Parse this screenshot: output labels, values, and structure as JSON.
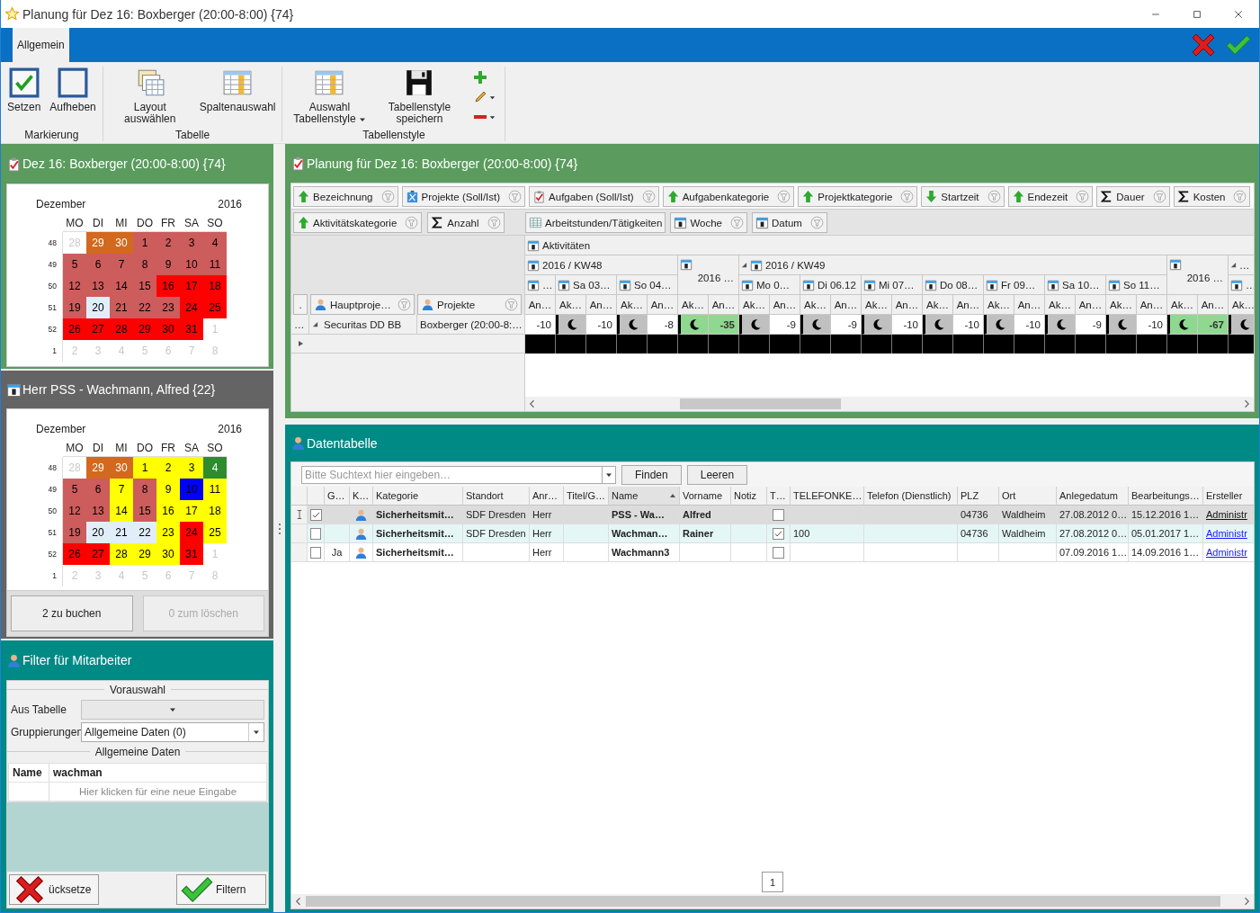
{
  "window": {
    "title": "Planung für Dez 16: Boxberger (20:00-8:00) {74}"
  },
  "ribbon": {
    "tabs": [
      {
        "label": "Allgemein",
        "selected": true
      }
    ],
    "groups": [
      {
        "label": "Markierung",
        "buttons": [
          {
            "label": "Setzen",
            "kind": "check",
            "dropdown": false
          },
          {
            "label": "Aufheben",
            "kind": "uncheck",
            "dropdown": false
          }
        ]
      },
      {
        "label": "Tabelle",
        "buttons": [
          {
            "label": "Layout auswählen",
            "kind": "layouts",
            "dropdown": false
          },
          {
            "label": "Spaltenauswahl",
            "kind": "columns",
            "dropdown": false
          }
        ]
      },
      {
        "label": "Tabellenstyle",
        "buttons": [
          {
            "label": "Auswahl Tabellenstyle",
            "kind": "styles",
            "dropdown": true
          },
          {
            "label": "Tabellenstyle speichern",
            "kind": "save",
            "dropdown": false
          }
        ]
      }
    ]
  },
  "booking_calendar": {
    "title": "Dez 16: Boxberger (20:00-8:00) {74}",
    "month": "Dezember",
    "year": "2016",
    "weekdays": [
      "MO",
      "DI",
      "MI",
      "DO",
      "FR",
      "SA",
      "SO"
    ],
    "weeks": [
      {
        "number": "48",
        "days": [
          {
            "day": "28",
            "outside": true
          },
          {
            "day": "29",
            "outside": false,
            "color": "#d2691e"
          },
          {
            "day": "30",
            "outside": false,
            "color": "#d2691e"
          },
          {
            "day": "1",
            "outside": false,
            "color": "#cd5c5c"
          },
          {
            "day": "2",
            "outside": false,
            "color": "#cd5c5c"
          },
          {
            "day": "3",
            "outside": false,
            "color": "#cd5c5c"
          },
          {
            "day": "4",
            "outside": false,
            "color": "#cd5c5c"
          }
        ]
      },
      {
        "number": "49",
        "days": [
          {
            "day": "5",
            "outside": false,
            "color": "#cd5c5c"
          },
          {
            "day": "6",
            "outside": false,
            "color": "#cd5c5c"
          },
          {
            "day": "7",
            "outside": false,
            "color": "#cd5c5c"
          },
          {
            "day": "8",
            "outside": false,
            "color": "#cd5c5c"
          },
          {
            "day": "9",
            "outside": false,
            "color": "#cd5c5c"
          },
          {
            "day": "10",
            "outside": false,
            "color": "#cd5c5c"
          },
          {
            "day": "11",
            "outside": false,
            "color": "#cd5c5c"
          }
        ]
      },
      {
        "number": "50",
        "days": [
          {
            "day": "12",
            "outside": false,
            "color": "#cd5c5c"
          },
          {
            "day": "13",
            "outside": false,
            "color": "#cd5c5c"
          },
          {
            "day": "14",
            "outside": false,
            "color": "#cd5c5c"
          },
          {
            "day": "15",
            "outside": false,
            "color": "#cd5c5c"
          },
          {
            "day": "16",
            "outside": false,
            "color": "#ff0000"
          },
          {
            "day": "17",
            "outside": false,
            "color": "#ff0000"
          },
          {
            "day": "18",
            "outside": false,
            "color": "#ff0000"
          }
        ]
      },
      {
        "number": "51",
        "days": [
          {
            "day": "19",
            "outside": false,
            "color": "#cd5c5c"
          },
          {
            "day": "20",
            "outside": false,
            "color": "#e1eefa"
          },
          {
            "day": "21",
            "outside": false,
            "color": "#cd5c5c"
          },
          {
            "day": "22",
            "outside": false,
            "color": "#cd5c5c"
          },
          {
            "day": "23",
            "outside": false,
            "color": "#cd5c5c"
          },
          {
            "day": "24",
            "outside": false,
            "color": "#ff0000"
          },
          {
            "day": "25",
            "outside": false,
            "color": "#ff0000"
          }
        ]
      },
      {
        "number": "52",
        "days": [
          {
            "day": "26",
            "outside": false,
            "color": "#ff0000"
          },
          {
            "day": "27",
            "outside": false,
            "color": "#ff0000"
          },
          {
            "day": "28",
            "outside": false,
            "color": "#ff0000"
          },
          {
            "day": "29",
            "outside": false,
            "color": "#ff0000"
          },
          {
            "day": "30",
            "outside": false,
            "color": "#ff0000"
          },
          {
            "day": "31",
            "outside": false,
            "color": "#ff0000"
          },
          {
            "day": "1",
            "outside": true
          }
        ]
      },
      {
        "number": "1",
        "days": [
          {
            "day": "2",
            "outside": true
          },
          {
            "day": "3",
            "outside": true
          },
          {
            "day": "4",
            "outside": true
          },
          {
            "day": "5",
            "outside": true
          },
          {
            "day": "6",
            "outside": true
          },
          {
            "day": "7",
            "outside": true
          },
          {
            "day": "8",
            "outside": true
          }
        ]
      }
    ]
  },
  "employee_calendar": {
    "title": "Herr PSS - Wachmann, Alfred {22}",
    "month": "Dezember",
    "year": "2016",
    "weekdays": [
      "MO",
      "DI",
      "MI",
      "DO",
      "FR",
      "SA",
      "SO"
    ],
    "weeks": [
      {
        "number": "48",
        "days": [
          {
            "day": "28",
            "outside": true
          },
          {
            "day": "29",
            "outside": false,
            "color": "#d2691e"
          },
          {
            "day": "30",
            "outside": false,
            "color": "#d2691e"
          },
          {
            "day": "1",
            "outside": false,
            "color": "#ffff00"
          },
          {
            "day": "2",
            "outside": false,
            "color": "#ffff00"
          },
          {
            "day": "3",
            "outside": false,
            "color": "#ffff00"
          },
          {
            "day": "4",
            "outside": false,
            "color": "#2e8b2e"
          }
        ]
      },
      {
        "number": "49",
        "days": [
          {
            "day": "5",
            "outside": false,
            "color": "#cd5c5c"
          },
          {
            "day": "6",
            "outside": false,
            "color": "#cd5c5c"
          },
          {
            "day": "7",
            "outside": false,
            "color": "#ffff00"
          },
          {
            "day": "8",
            "outside": false,
            "color": "#cd5c5c"
          },
          {
            "day": "9",
            "outside": false,
            "color": "#ffff00"
          },
          {
            "day": "10",
            "outside": false,
            "color": "#0000ff"
          },
          {
            "day": "11",
            "outside": false,
            "color": "#ffff00"
          }
        ]
      },
      {
        "number": "50",
        "days": [
          {
            "day": "12",
            "outside": false,
            "color": "#cd5c5c"
          },
          {
            "day": "13",
            "outside": false,
            "color": "#cd5c5c"
          },
          {
            "day": "14",
            "outside": false,
            "color": "#ffff00"
          },
          {
            "day": "15",
            "outside": false,
            "color": "#cd5c5c"
          },
          {
            "day": "16",
            "outside": false,
            "color": "#ffff00"
          },
          {
            "day": "17",
            "outside": false,
            "color": "#ffff00"
          },
          {
            "day": "18",
            "outside": false,
            "color": "#ffff00"
          }
        ]
      },
      {
        "number": "51",
        "days": [
          {
            "day": "19",
            "outside": false,
            "color": "#cd5c5c"
          },
          {
            "day": "20",
            "outside": false,
            "color": "#e1eefa"
          },
          {
            "day": "21",
            "outside": false,
            "color": "#e1eefa"
          },
          {
            "day": "22",
            "outside": false,
            "color": "#e1eefa"
          },
          {
            "day": "23",
            "outside": false,
            "color": "#ffff00"
          },
          {
            "day": "24",
            "outside": false,
            "color": "#ff0000"
          },
          {
            "day": "25",
            "outside": false,
            "color": "#ffff00"
          }
        ]
      },
      {
        "number": "52",
        "days": [
          {
            "day": "26",
            "outside": false,
            "color": "#ff0000"
          },
          {
            "day": "27",
            "outside": false,
            "color": "#ff0000"
          },
          {
            "day": "28",
            "outside": false,
            "color": "#ffff00"
          },
          {
            "day": "29",
            "outside": false,
            "color": "#ffff00"
          },
          {
            "day": "30",
            "outside": false,
            "color": "#ffff00"
          },
          {
            "day": "31",
            "outside": false,
            "color": "#ff0000"
          },
          {
            "day": "1",
            "outside": true
          }
        ]
      },
      {
        "number": "1",
        "days": [
          {
            "day": "2",
            "outside": true
          },
          {
            "day": "3",
            "outside": true
          },
          {
            "day": "4",
            "outside": true
          },
          {
            "day": "5",
            "outside": true
          },
          {
            "day": "6",
            "outside": true
          },
          {
            "day": "7",
            "outside": true
          },
          {
            "day": "8",
            "outside": true
          }
        ]
      }
    ],
    "buttons": [
      {
        "label": "2 zu buchen",
        "disabled": false
      },
      {
        "label": "0 zum löschen",
        "disabled": true
      }
    ]
  },
  "employee_filter": {
    "title": "Filter für Mitarbeiter",
    "preselection": {
      "legend": "Vorauswahl",
      "fields": [
        {
          "label": "Aus Tabelle",
          "disabled": true
        },
        {
          "label": "Gruppierungen",
          "value": "Allgemeine Daten (0)",
          "disabled": false
        }
      ]
    },
    "general": {
      "legend": "Allgemeine Daten",
      "rows": [
        {
          "name": "Name",
          "value": "wachman"
        }
      ],
      "new_row_hint": "Hier klicken für eine neue Eingabe"
    },
    "buttons": [
      {
        "label": "ücksetze",
        "kind": "reset"
      },
      {
        "label": "Filtern",
        "kind": "apply"
      }
    ]
  },
  "planning": {
    "title": "Planung für Dez 16: Boxberger (20:00-8:00) {74}",
    "filter_fields": [
      {
        "label": "Bezeichnung",
        "kind": "ascending",
        "filter": true
      },
      {
        "label": "Projekte (Soll/Ist)",
        "kind": "projects",
        "filter": true
      },
      {
        "label": "Aufgaben (Soll/Ist)",
        "kind": "tasks",
        "filter": true
      },
      {
        "label": "Aufgabenkategorie",
        "kind": "ascending",
        "filter": true
      },
      {
        "label": "Projektkategorie",
        "kind": "ascending",
        "filter": true
      },
      {
        "label": "Startzeit",
        "kind": "descending",
        "filter": true
      },
      {
        "label": "Endezeit",
        "kind": "ascending",
        "filter": true
      },
      {
        "label": "Dauer",
        "kind": "sum",
        "filter": true
      },
      {
        "label": "Kosten",
        "kind": "sum",
        "filter": true
      }
    ],
    "data_fields": [
      {
        "label": "Aktivitätskategorie",
        "kind": "ascending",
        "filter": true
      },
      {
        "label": "Anzahl",
        "kind": "sum",
        "filter": true
      }
    ],
    "column_fields": [
      {
        "label": "Arbeitstunden/Tätigkeiten",
        "kind": "grid",
        "filter": false
      },
      {
        "label": "Woche",
        "kind": "date",
        "filter": true
      },
      {
        "label": "Datum",
        "kind": "date",
        "filter": true
      }
    ],
    "row_field_stub": ".",
    "row_fields": [
      {
        "label": "Hauptproje…",
        "kind": "person",
        "filter": true
      },
      {
        "label": "Projekte",
        "kind": "person",
        "filter": true
      }
    ],
    "column_root": "Aktivitäten",
    "column_groups": [
      {
        "kind": "week",
        "label": "2016 / KW48",
        "expanded": false,
        "days": [
          {
            "label": "…",
            "cells": [
              {
                "header": "An…",
                "kind": "number",
                "value": "-10"
              }
            ]
          },
          {
            "label": "Sa 03…",
            "cells": [
              {
                "header": "Ak…",
                "kind": "moon"
              },
              {
                "header": "An…",
                "kind": "number",
                "value": "-10"
              }
            ]
          },
          {
            "label": "So 04…",
            "cells": [
              {
                "header": "Ak…",
                "kind": "moon"
              },
              {
                "header": "An…",
                "kind": "number",
                "value": "-8"
              }
            ]
          }
        ]
      },
      {
        "kind": "total",
        "label": "2016 …",
        "cells": [
          {
            "header": "Ak…",
            "kind": "moon"
          },
          {
            "header": "An…",
            "kind": "number",
            "value": "-35"
          }
        ]
      },
      {
        "kind": "week",
        "label": "2016 / KW49",
        "expanded": true,
        "days": [
          {
            "label": "Mo 0…",
            "cells": [
              {
                "header": "Ak…",
                "kind": "moon"
              },
              {
                "header": "An…",
                "kind": "number",
                "value": "-9"
              }
            ]
          },
          {
            "label": "Di 06.12",
            "cells": [
              {
                "header": "Ak…",
                "kind": "moon"
              },
              {
                "header": "An…",
                "kind": "number",
                "value": "-9"
              }
            ]
          },
          {
            "label": "Mi 07…",
            "cells": [
              {
                "header": "Ak…",
                "kind": "moon"
              },
              {
                "header": "An…",
                "kind": "number",
                "value": "-10"
              }
            ]
          },
          {
            "label": "Do 08…",
            "cells": [
              {
                "header": "Ak…",
                "kind": "moon"
              },
              {
                "header": "An…",
                "kind": "number",
                "value": "-10"
              }
            ]
          },
          {
            "label": "Fr 09…",
            "cells": [
              {
                "header": "Ak…",
                "kind": "moon"
              },
              {
                "header": "An…",
                "kind": "number",
                "value": "-10"
              }
            ]
          },
          {
            "label": "Sa 10…",
            "cells": [
              {
                "header": "Ak…",
                "kind": "moon"
              },
              {
                "header": "An…",
                "kind": "number",
                "value": "-9"
              }
            ]
          },
          {
            "label": "So 11…",
            "cells": [
              {
                "header": "Ak…",
                "kind": "moon"
              },
              {
                "header": "An…",
                "kind": "number",
                "value": "-10"
              }
            ]
          }
        ]
      },
      {
        "kind": "total",
        "label": "2016 …",
        "cells": [
          {
            "header": "Ak…",
            "kind": "moon"
          },
          {
            "header": "An…",
            "kind": "number",
            "value": "-67"
          }
        ]
      },
      {
        "kind": "week",
        "label": "…",
        "expanded": true,
        "days": [
          {
            "label": "…",
            "cells": [
              {
                "header": "Ak…",
                "kind": "moon"
              }
            ]
          }
        ]
      }
    ],
    "rows": [
      {
        "stub": "…",
        "project": "Securitas DD BB",
        "expanded": true,
        "subproject": "Boxberger (20:00-8:…"
      }
    ]
  },
  "data_table": {
    "title": "Datentabelle",
    "search": {
      "placeholder": "Bitte Suchtext hier eingeben…"
    },
    "buttons": [
      "Finden",
      "Leeren"
    ],
    "columns": [
      {
        "label": "G…",
        "kind": "text",
        "sorted": false
      },
      {
        "label": "K…",
        "kind": "icon",
        "sorted": false
      },
      {
        "label": "Kategorie",
        "kind": "bold",
        "sorted": false
      },
      {
        "label": "Standort",
        "kind": "text",
        "sorted": false
      },
      {
        "label": "Anr…",
        "kind": "text",
        "sorted": false
      },
      {
        "label": "Titel/G…",
        "kind": "text",
        "sorted": false
      },
      {
        "label": "Name",
        "kind": "bold",
        "sorted": true
      },
      {
        "label": "Vorname",
        "kind": "bold",
        "sorted": false
      },
      {
        "label": "Notiz",
        "kind": "text",
        "sorted": false
      },
      {
        "label": "T…",
        "kind": "check",
        "sorted": false
      },
      {
        "label": "TELEFONKE…",
        "kind": "text",
        "sorted": false
      },
      {
        "label": "Telefon (Dienstlich)",
        "kind": "text",
        "sorted": false
      },
      {
        "label": "PLZ",
        "kind": "text",
        "sorted": false
      },
      {
        "label": "Ort",
        "kind": "text",
        "sorted": false
      },
      {
        "label": "Anlegedatum",
        "kind": "text",
        "sorted": false
      },
      {
        "label": "Bearbeitungs…",
        "kind": "text",
        "sorted": false
      },
      {
        "label": "Ersteller",
        "kind": "link",
        "sorted": false
      }
    ],
    "rows": [
      {
        "selected": true,
        "focused": true,
        "checked": true,
        "cells": [
          {},
          {
            "kind": "person"
          },
          {
            "text": "Sicherheitsmit…"
          },
          {
            "text": "SDF Dresden"
          },
          {
            "text": "Herr"
          },
          {},
          {
            "text": "PSS - Wa…"
          },
          {
            "text": "Alfred"
          },
          {},
          {
            "checked": false
          },
          {},
          {},
          {
            "text": "04736"
          },
          {
            "text": "Waldheim"
          },
          {
            "text": "27.08.2012 0…"
          },
          {
            "text": "15.12.2016 1…"
          },
          {
            "text": "Administr"
          }
        ]
      },
      {
        "selected": false,
        "focused": false,
        "checked": false,
        "cells": [
          {},
          {
            "kind": "person"
          },
          {
            "text": "Sicherheitsmit…"
          },
          {
            "text": "SDF Dresden"
          },
          {
            "text": "Herr"
          },
          {},
          {
            "text": "Wachman…"
          },
          {
            "text": "Rainer"
          },
          {},
          {
            "checked": true
          },
          {
            "text": "100"
          },
          {},
          {
            "text": "04736"
          },
          {
            "text": "Waldheim"
          },
          {
            "text": "27.08.2012 0…"
          },
          {
            "text": "05.01.2017 1…"
          },
          {
            "text": "Administr"
          }
        ]
      },
      {
        "selected": false,
        "focused": false,
        "checked": false,
        "cells": [
          {
            "text": "Ja"
          },
          {
            "kind": "person"
          },
          {
            "text": "Sicherheitsmit…"
          },
          {},
          {
            "text": "Herr"
          },
          {},
          {
            "text": "Wachmann3"
          },
          {},
          {},
          {
            "checked": false
          },
          {},
          {},
          {},
          {},
          {
            "text": "07.09.2016 1…"
          },
          {
            "text": "14.09.2016 1…"
          },
          {
            "text": "Administr"
          }
        ]
      }
    ],
    "pager": {
      "pages": [
        {
          "label": "1",
          "selected": true
        }
      ]
    }
  }
}
